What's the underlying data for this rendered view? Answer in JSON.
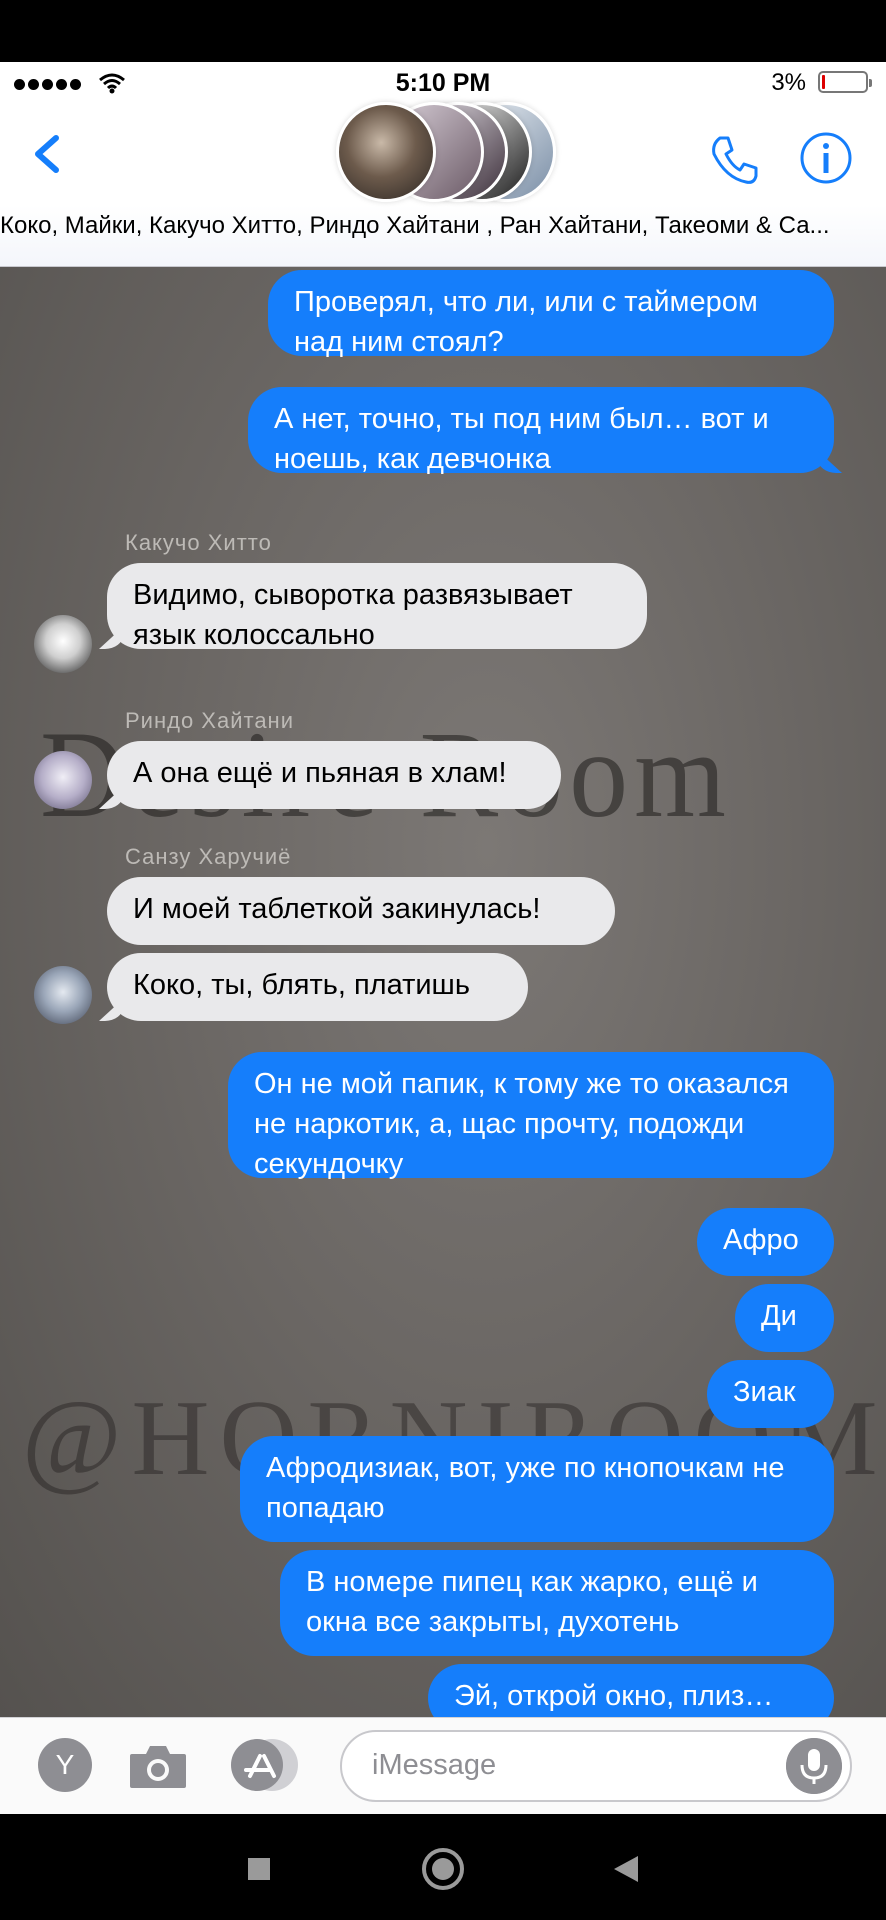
{
  "status_bar": {
    "time": "5:10 PM",
    "battery_percent": "3%"
  },
  "header": {
    "group_names": "Коко, Майки, Какучо Хитто, Риндо Хайтани , Ран Хайтани, Такеоми & Са..."
  },
  "messages": [
    {
      "dir": "out",
      "text": "Проверял, что ли, или с таймером над ним стоял?"
    },
    {
      "dir": "out",
      "text": "А нет, точно, ты под ним был… вот и ноешь, как девчонка"
    },
    {
      "dir": "in",
      "sender": "Какучо Хитто",
      "text": "Видимо, сыворотка развязывает язык колоссально"
    },
    {
      "dir": "in",
      "sender": "Риндо Хайтани",
      "text": "А она ещё и пьяная в хлам!"
    },
    {
      "dir": "in",
      "sender": "Санзу Харучиё",
      "text": "И моей таблеткой закинулась!"
    },
    {
      "dir": "in",
      "text": "Коко, ты, блять, платишь"
    },
    {
      "dir": "out",
      "text": "Он не мой папик, к тому же то оказался не наркотик, а, щас прочту, подожди секундочку"
    },
    {
      "dir": "out",
      "text": "Афро"
    },
    {
      "dir": "out",
      "text": "Ди"
    },
    {
      "dir": "out",
      "text": "Зиак"
    },
    {
      "dir": "out",
      "text": "Афродизиак, вот, уже по кнопочкам не попадаю"
    },
    {
      "dir": "out",
      "text": "В номере пипец как жарко, ещё и окна все закрыты, духотень"
    },
    {
      "dir": "out",
      "text": "Эй, открой окно, плиз…"
    }
  ],
  "watermarks": {
    "line1": "Desire Room",
    "line2": "@HORNIROOM"
  },
  "composer": {
    "apps_label": "Y",
    "placeholder": "iMessage"
  },
  "colors": {
    "outgoing": "#157efb",
    "incoming": "#e9e9eb",
    "accent": "#157efb"
  },
  "icons": [
    "back-chevron-icon",
    "phone-icon",
    "info-icon",
    "camera-icon",
    "app-store-icon",
    "microphone-icon",
    "square-icon",
    "home-circle-icon",
    "back-triangle-icon"
  ]
}
